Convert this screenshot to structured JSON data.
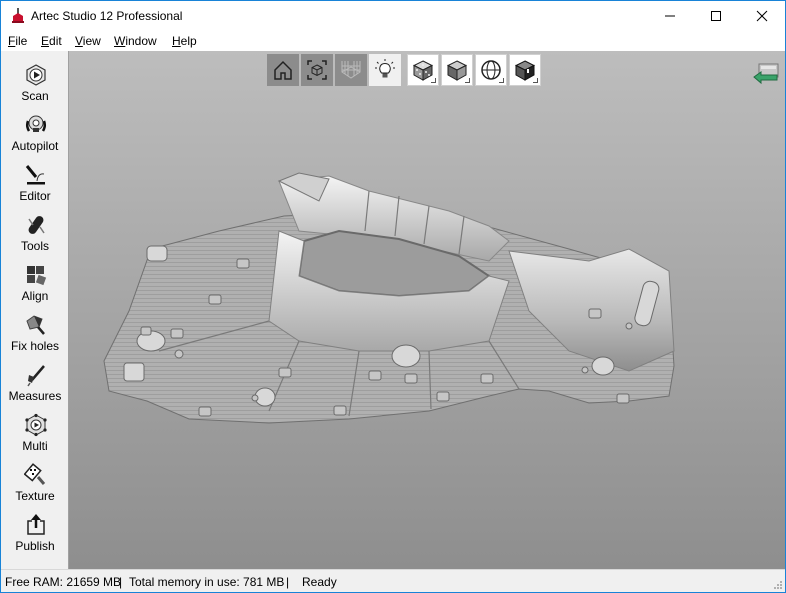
{
  "window": {
    "title": "Artec Studio 12 Professional",
    "controls": {
      "minimize": "minimize-icon",
      "maximize": "maximize-icon",
      "close": "close-icon"
    }
  },
  "menu": [
    {
      "label": "File",
      "accel": "F",
      "rest": "ile"
    },
    {
      "label": "Edit",
      "accel": "E",
      "rest": "dit"
    },
    {
      "label": "View",
      "accel": "V",
      "rest": "iew"
    },
    {
      "label": "Window",
      "accel": "W",
      "rest": "indow"
    },
    {
      "label": "Help",
      "accel": "H",
      "rest": "elp"
    }
  ],
  "sidebar": {
    "items": [
      {
        "label": "Scan",
        "icon": "scan-icon"
      },
      {
        "label": "Autopilot",
        "icon": "autopilot-icon"
      },
      {
        "label": "Editor",
        "icon": "editor-icon"
      },
      {
        "label": "Tools",
        "icon": "tools-icon"
      },
      {
        "label": "Align",
        "icon": "align-icon"
      },
      {
        "label": "Fix holes",
        "icon": "fix-holes-icon"
      },
      {
        "label": "Measures",
        "icon": "measures-icon"
      },
      {
        "label": "Multi",
        "icon": "multi-icon"
      },
      {
        "label": "Texture",
        "icon": "texture-icon"
      },
      {
        "label": "Publish",
        "icon": "publish-icon"
      }
    ]
  },
  "viewport_toolbar": {
    "buttons": [
      {
        "name": "home-view",
        "icon": "home-icon",
        "state": "active"
      },
      {
        "name": "fit-view",
        "icon": "fit-to-view-icon",
        "state": "active"
      },
      {
        "name": "grid-toggle",
        "icon": "grid-icon",
        "state": "active"
      },
      {
        "name": "lighting-toggle",
        "icon": "light-bulb-icon",
        "state": "normal"
      },
      {
        "name": "texture-mode",
        "icon": "textured-cube-icon",
        "state": "normal"
      },
      {
        "name": "shaded-mode",
        "icon": "shaded-cube-icon",
        "state": "normal"
      },
      {
        "name": "wireframe-projection",
        "icon": "sphere-icon",
        "state": "normal"
      },
      {
        "name": "backface-mode",
        "icon": "dark-cube-icon",
        "state": "normal"
      }
    ],
    "back_button_icon": "back-arrow-icon"
  },
  "statusbar": {
    "free_ram": "Free RAM: 21659 MB",
    "sep1": "|",
    "memory_in_use": "Total memory in use: 781 MB",
    "sep2": "|",
    "status": "Ready"
  }
}
